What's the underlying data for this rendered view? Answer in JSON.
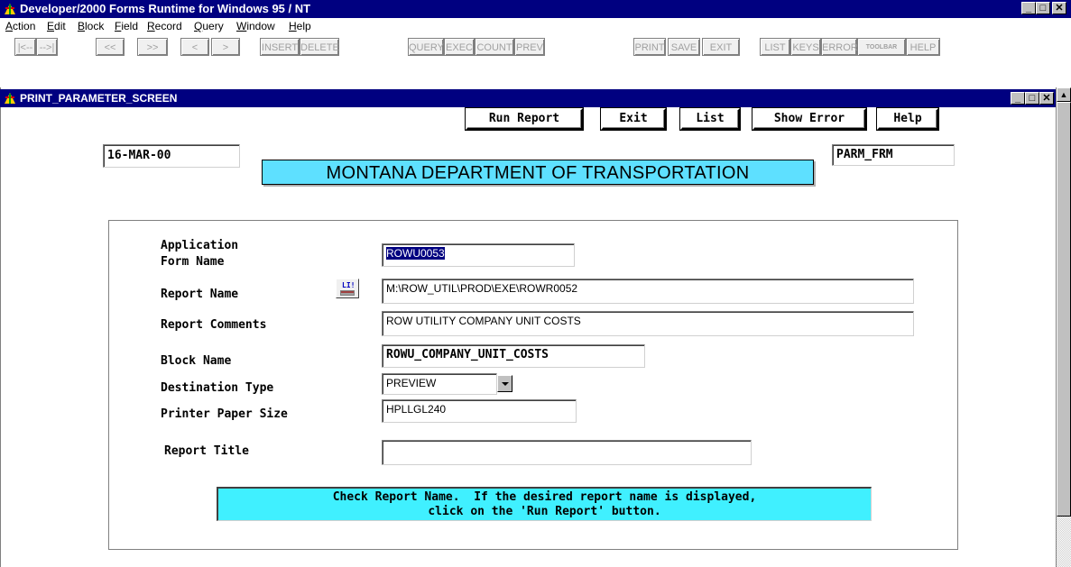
{
  "app": {
    "title": "Developer/2000 Forms Runtime for Windows 95 / NT",
    "window_controls": [
      "_",
      "□",
      "✕"
    ]
  },
  "menu": [
    {
      "label": "Action",
      "u": "A",
      "rest": "ction"
    },
    {
      "label": "Edit",
      "u": "E",
      "rest": "dit"
    },
    {
      "label": "Block",
      "u": "B",
      "rest": "lock"
    },
    {
      "label": "Field",
      "u": "F",
      "rest": "ield"
    },
    {
      "label": "Record",
      "u": "R",
      "rest": "ecord"
    },
    {
      "label": "Query",
      "u": "Q",
      "rest": "uery"
    },
    {
      "label": "Window",
      "u": "W",
      "rest": "indow"
    },
    {
      "label": "Help",
      "u": "H",
      "rest": "elp"
    }
  ],
  "toolbar": {
    "first": "|<--",
    "next": "-->|",
    "prev_block": "<<",
    "next_block": ">>",
    "prev_rec": "<",
    "next_rec": ">",
    "insert": "INSERT",
    "delete": "DELETE",
    "query": "QUERY",
    "exec": "EXEC",
    "count": "COUNT",
    "prev": "PREV",
    "print": "PRINT",
    "save": "SAVE",
    "exit": "EXIT",
    "list": "LIST",
    "keys": "KEYS",
    "error": "ERROR",
    "toolbar": "TOOLBAR",
    "help": "HELP"
  },
  "form": {
    "window_title": "PRINT_PARAMETER_SCREEN",
    "buttons": {
      "run_report": "Run Report",
      "exit": "Exit",
      "list": "List",
      "show_error": "Show Error",
      "help": "Help"
    },
    "date": "16-MAR-00",
    "form_id": "PARM_FRM",
    "banner": "MONTANA DEPARTMENT OF TRANSPORTATION",
    "lov_icon_text": "LI!",
    "labels": {
      "app_form_1": "Application",
      "app_form_2": "Form Name",
      "report_name": "Report Name",
      "report_comments": "Report Comments",
      "block_name": "Block Name",
      "destination_type": "Destination Type",
      "printer_paper_size": "Printer Paper Size",
      "report_title": "Report Title"
    },
    "values": {
      "app_form_name": "ROWU0053",
      "report_name": "M:\\ROW_UTIL\\PROD\\EXE\\ROWR0052",
      "report_comments": "ROW UTILITY COMPANY UNIT COSTS",
      "block_name": "ROWU_COMPANY_UNIT_COSTS",
      "destination_type": "PREVIEW",
      "printer_paper_size": "HPLLGL240",
      "report_title": ""
    },
    "message_line1": "Check Report Name.  If the desired report name is displayed,",
    "message_line2": "click on the 'Run Report' button."
  }
}
